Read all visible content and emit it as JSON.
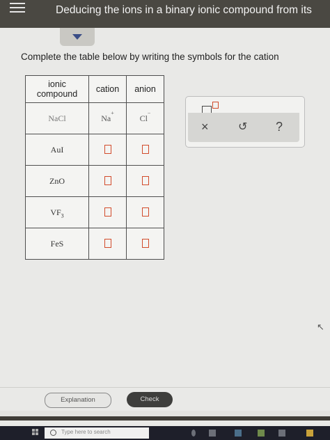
{
  "header": {
    "title": "Deducing the ions in a binary ionic compound from its"
  },
  "prompt": "Complete the table below by writing the symbols for the cation",
  "table": {
    "headers": {
      "ionic": "ionic",
      "compound": "compound",
      "cation": "cation",
      "anion": "anion"
    },
    "rows": [
      {
        "compound": "NaCl",
        "cation": "Na",
        "cation_charge": "+",
        "anion": "Cl",
        "anion_charge": "−"
      },
      {
        "compound": "AuI"
      },
      {
        "compound": "ZnO"
      },
      {
        "compound": "VF",
        "compound_sub": "3"
      },
      {
        "compound": "FeS"
      }
    ]
  },
  "palette": {
    "clear_symbol": "×",
    "undo_symbol": "↺",
    "help_symbol": "?"
  },
  "footer": {
    "explanation_label": "Explanation",
    "check_label": "Check"
  },
  "taskbar": {
    "search_placeholder": "Type here to search"
  },
  "colors": {
    "header_bg": "#4a4842",
    "box_outline": "#d24b2b",
    "collapse_arrow": "#3a4d86"
  }
}
